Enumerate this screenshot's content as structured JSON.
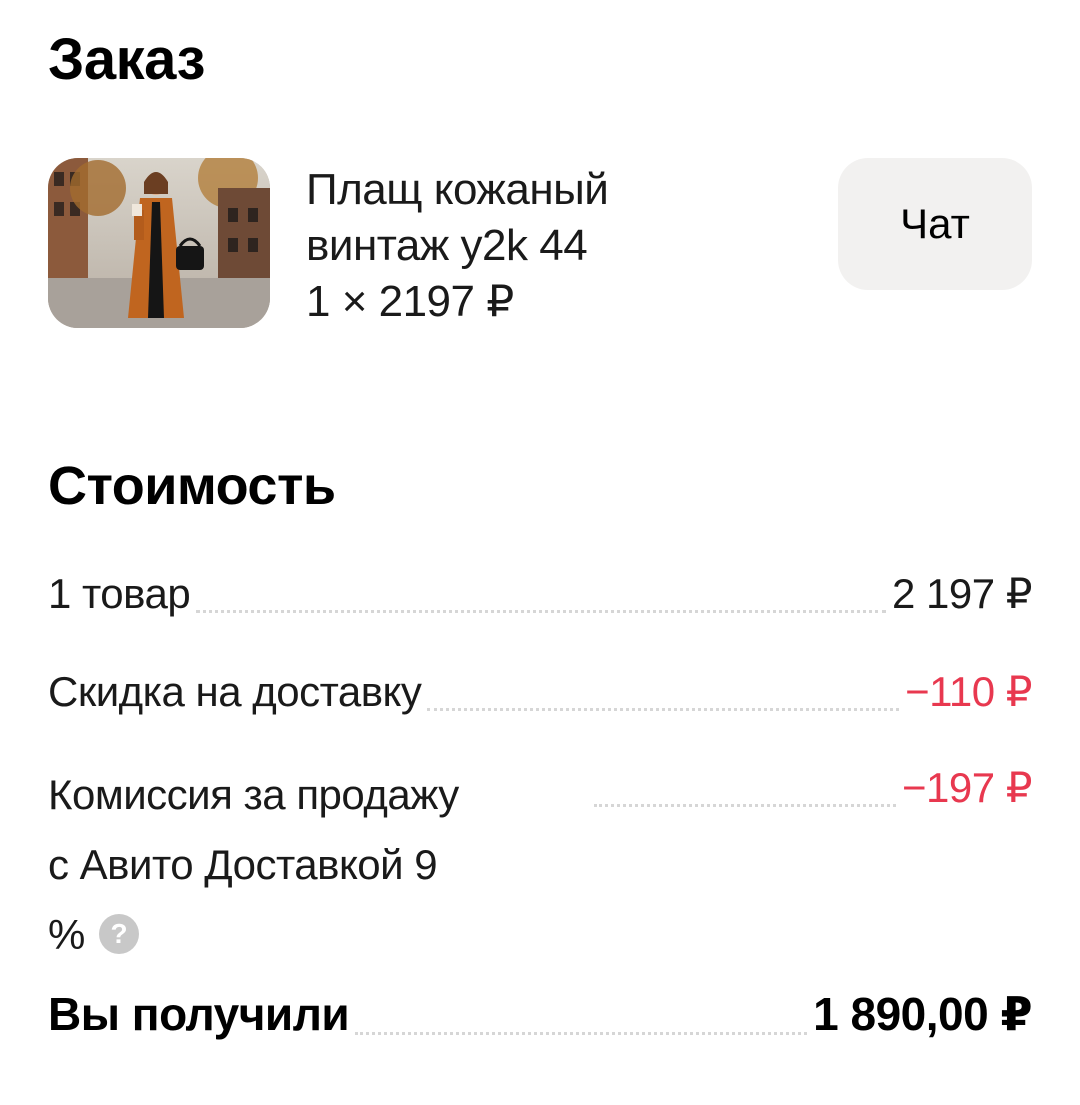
{
  "order": {
    "title": "Заказ",
    "product": {
      "name_line1": "Плащ кожаный",
      "name_line2": "винтаж y2k 44",
      "qty_price": "1 × 2197 ₽",
      "image_icon": "product-photo"
    },
    "chat_label": "Чат"
  },
  "cost": {
    "title": "Стоимость",
    "rows": [
      {
        "label": "1 товар",
        "value": "2 197 ₽",
        "negative": false
      },
      {
        "label": "Скидка на доставку",
        "value": "−110 ₽",
        "negative": true
      },
      {
        "label_line1": "Комиссия за продажу",
        "label_line2": "с Авито Доставкой 9",
        "label_line3": "%",
        "value": "−197 ₽",
        "negative": true,
        "help_icon": "?"
      }
    ],
    "total": {
      "label": "Вы получили",
      "value": "1 890,00 ₽"
    }
  },
  "colors": {
    "negative": "#e8384f",
    "chat_bg": "#f2f1f0",
    "help_icon_bg": "#c8c8c8"
  }
}
